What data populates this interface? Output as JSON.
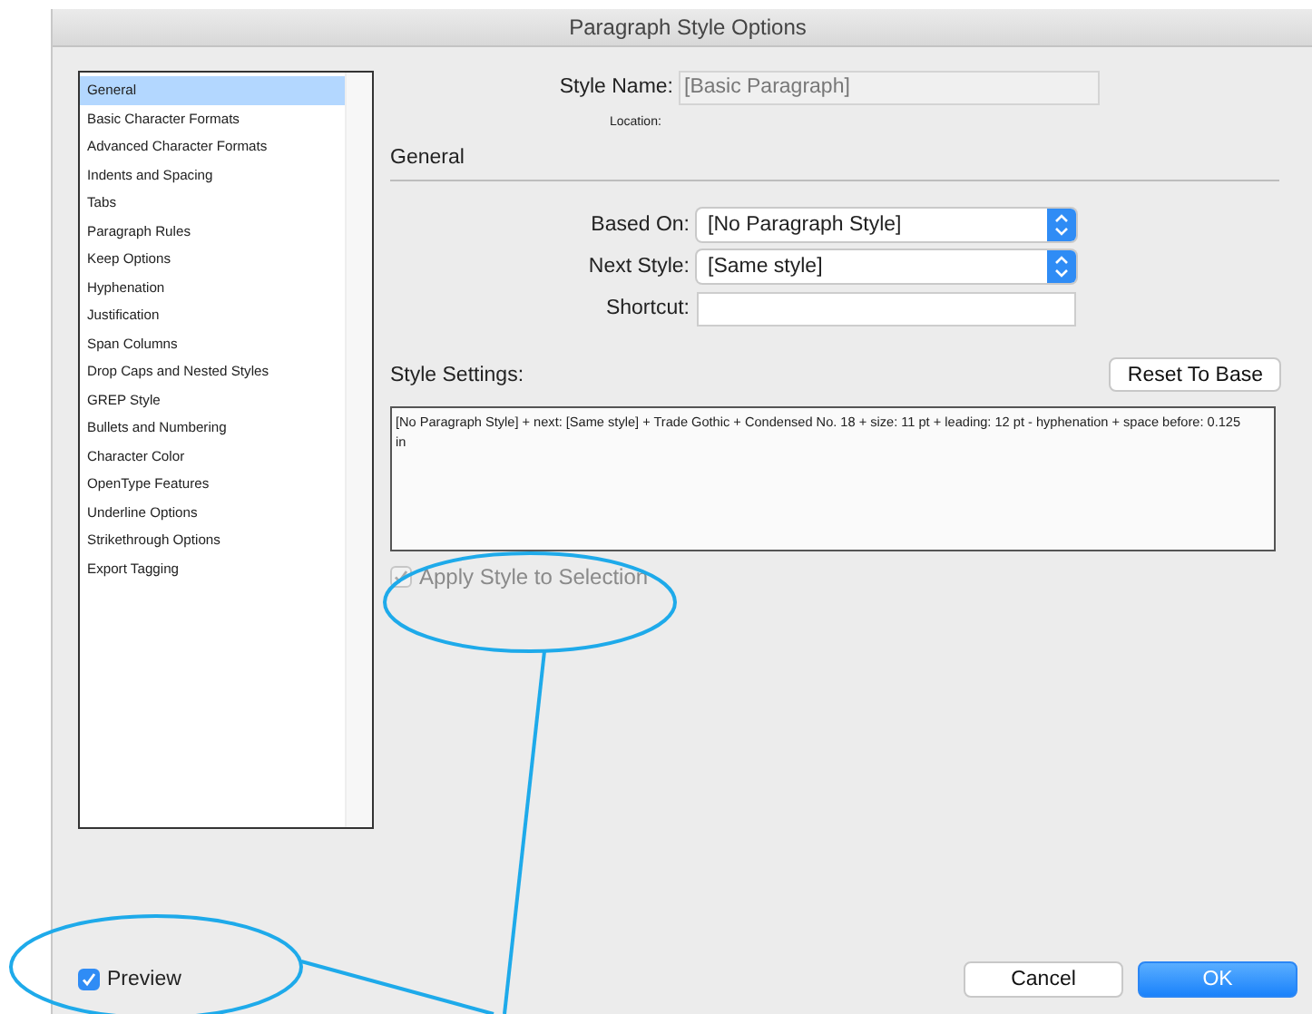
{
  "window": {
    "title": "Paragraph Style Options"
  },
  "sidebar": {
    "items": [
      {
        "label": "General",
        "selected": true
      },
      {
        "label": "Basic Character Formats",
        "selected": false
      },
      {
        "label": "Advanced Character Formats",
        "selected": false
      },
      {
        "label": "Indents and Spacing",
        "selected": false
      },
      {
        "label": "Tabs",
        "selected": false
      },
      {
        "label": "Paragraph Rules",
        "selected": false
      },
      {
        "label": "Keep Options",
        "selected": false
      },
      {
        "label": "Hyphenation",
        "selected": false
      },
      {
        "label": "Justification",
        "selected": false
      },
      {
        "label": "Span Columns",
        "selected": false
      },
      {
        "label": "Drop Caps and Nested Styles",
        "selected": false
      },
      {
        "label": "GREP Style",
        "selected": false
      },
      {
        "label": "Bullets and Numbering",
        "selected": false
      },
      {
        "label": "Character Color",
        "selected": false
      },
      {
        "label": "OpenType Features",
        "selected": false
      },
      {
        "label": "Underline Options",
        "selected": false
      },
      {
        "label": "Strikethrough Options",
        "selected": false
      },
      {
        "label": "Export Tagging",
        "selected": false
      }
    ]
  },
  "style_name": {
    "label": "Style Name:",
    "value": "[Basic Paragraph]"
  },
  "location": {
    "label": "Location:"
  },
  "section_title": "General",
  "fields": [
    {
      "kind": "select",
      "label": "Based On:",
      "value": "[No Paragraph Style]"
    },
    {
      "kind": "select",
      "label": "Next Style:",
      "value": "[Same style]"
    },
    {
      "kind": "text",
      "label": "Shortcut:"
    }
  ],
  "style_settings": {
    "label": "Style Settings:",
    "reset_button": "Reset To Base",
    "text": "[No Paragraph Style] + next: [Same style] + Trade Gothic + Condensed No. 18 + size: 11 pt + leading: 12 pt - hyphenation + space before: 0.125 in"
  },
  "apply_to_selection": {
    "label": "Apply Style to Selection",
    "checked": true,
    "disabled": true
  },
  "preview": {
    "label": "Preview",
    "checked": true,
    "disabled": false
  },
  "buttons": [
    {
      "label": "Cancel",
      "kind": "secondary"
    },
    {
      "label": "OK",
      "kind": "primary"
    }
  ]
}
